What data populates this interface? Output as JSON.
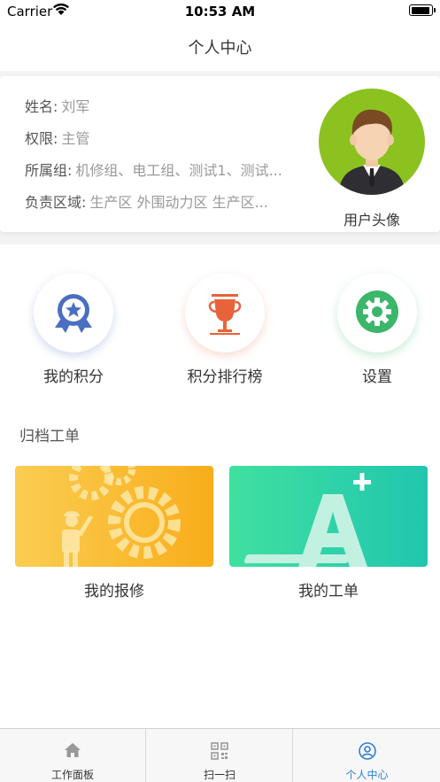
{
  "status_bar": {
    "carrier": "Carrier",
    "time": "10:53 AM"
  },
  "nav": {
    "title": "个人中心"
  },
  "profile": {
    "rows": [
      {
        "label": "姓名:",
        "value": "刘军"
      },
      {
        "label": "权限:",
        "value": "主管"
      },
      {
        "label": "所属组:",
        "value": "机修组、电工组、测试1、测试..."
      },
      {
        "label": "负责区域:",
        "value": "生产区 外围动力区 生产区..."
      }
    ],
    "avatar_caption": "用户头像",
    "avatar_color": "#8cc21f"
  },
  "features": [
    {
      "label": "我的积分",
      "icon": "medal-icon",
      "color": "#4a6fc2"
    },
    {
      "label": "积分排行榜",
      "icon": "trophy-icon",
      "color": "#e8623a"
    },
    {
      "label": "设置",
      "icon": "gear-icon",
      "color": "#3cb66a"
    }
  ],
  "archive": {
    "title": "归档工单",
    "cards": [
      {
        "label": "我的报修",
        "colors": [
          "#f9c84a",
          "#f9ad1a"
        ]
      },
      {
        "label": "我的工单",
        "colors": [
          "#3fe0a0",
          "#21c6ae"
        ]
      }
    ]
  },
  "tabs": [
    {
      "label": "工作面板",
      "icon": "home-icon"
    },
    {
      "label": "扫一扫",
      "icon": "qr-scan-icon"
    },
    {
      "label": "个人中心",
      "icon": "user-icon",
      "active": true
    }
  ],
  "colors": {
    "accent": "#2f7fd8"
  }
}
